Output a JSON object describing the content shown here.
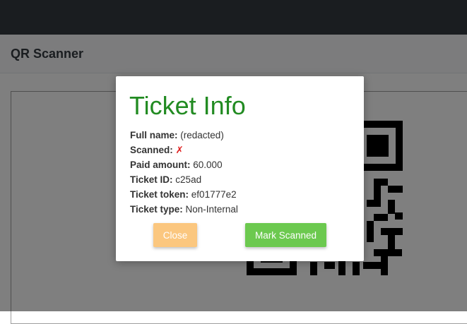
{
  "page": {
    "title": "QR Scanner"
  },
  "modal": {
    "title": "Ticket Info",
    "fields": [
      {
        "label": "Full name:",
        "value": "(redacted)"
      },
      {
        "label": "Scanned:",
        "value": "✗"
      },
      {
        "label": "Paid amount:",
        "value": "60.000"
      },
      {
        "label": "Ticket ID:",
        "value": "c25ad"
      },
      {
        "label": "Ticket token:",
        "value": "ef01777e2"
      },
      {
        "label": "Ticket type:",
        "value": "Non-Internal"
      }
    ],
    "buttons": {
      "close": "Close",
      "mark_scanned": "Mark Scanned"
    }
  },
  "colors": {
    "topbar": "#343a40",
    "title_green": "#228b22",
    "scanned_x": "#e02020",
    "close_button": "#fbc77f",
    "mark_button": "#6cc94f"
  },
  "icons": {
    "scanned_status": "cross-mark-icon"
  }
}
